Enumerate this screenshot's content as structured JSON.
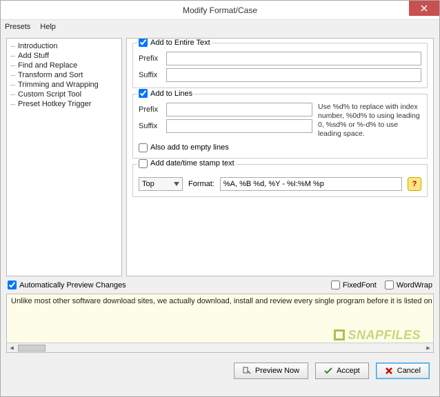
{
  "title": "Modify Format/Case",
  "menu": {
    "presets": "Presets",
    "help": "Help"
  },
  "sidebar": {
    "items": [
      {
        "label": "Introduction"
      },
      {
        "label": "Add Stuff"
      },
      {
        "label": "Find and Replace"
      },
      {
        "label": "Transform and Sort"
      },
      {
        "label": "Trimming and Wrapping"
      },
      {
        "label": "Custom Script Tool"
      },
      {
        "label": "Preset Hotkey Trigger"
      }
    ],
    "selected_index": 1
  },
  "panel": {
    "entire": {
      "title": "Add to Entire Text",
      "checked": true,
      "prefix_label": "Prefix",
      "prefix_value": "",
      "suffix_label": "Suffix",
      "suffix_value": ""
    },
    "lines": {
      "title": "Add to Lines",
      "checked": true,
      "prefix_label": "Prefix",
      "prefix_value": "",
      "suffix_label": "Suffix",
      "suffix_value": "",
      "hint": "Use %d% to replace with index number, %0d% to using leading 0, %sd% or %-d% to use leading space.",
      "empty_label": "Also add to empty lines",
      "empty_checked": false
    },
    "datetime": {
      "title": "Add date/time stamp text",
      "checked": false,
      "position_label": "Top",
      "format_label": "Format:",
      "format_value": "%A, %B %d, %Y - %I:%M %p"
    }
  },
  "options": {
    "auto_preview_label": "Automatically Preview Changes",
    "auto_preview_checked": true,
    "fixedfont_label": "FixedFont",
    "fixedfont_checked": false,
    "wordwrap_label": "WordWrap",
    "wordwrap_checked": false
  },
  "preview": {
    "text": "Unlike most other software download sites, we actually download, install and review every single program before it is listed on the sit",
    "watermark": "SNAPFILES"
  },
  "buttons": {
    "preview": "Preview Now",
    "accept": "Accept",
    "cancel": "Cancel"
  }
}
